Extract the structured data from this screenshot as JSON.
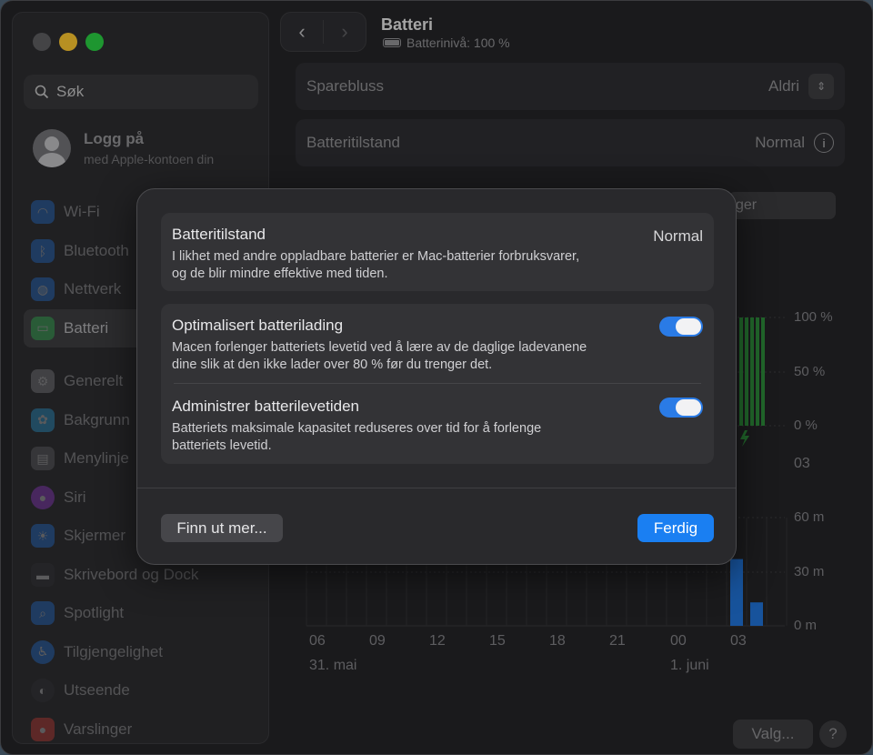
{
  "sidebar": {
    "search_placeholder": "Søk",
    "account": {
      "name": "Logg på",
      "sub": "med Apple-kontoen din"
    },
    "items": [
      {
        "label": "Wi-Fi",
        "icon": "wifi-icon",
        "color": "#2a7be6"
      },
      {
        "label": "Bluetooth",
        "icon": "bluetooth-icon",
        "color": "#2a7be6"
      },
      {
        "label": "Nettverk",
        "icon": "globe-icon",
        "color": "#2a7be6"
      },
      {
        "label": "Batteri",
        "icon": "battery-icon",
        "color": "#34c759"
      },
      {
        "label": "Generelt",
        "icon": "gear-icon",
        "color": "#8e8e93"
      },
      {
        "label": "Bakgrunn",
        "icon": "flower-icon",
        "color": "#2fa7e6"
      },
      {
        "label": "Menylinje",
        "icon": "menubar-icon",
        "color": "#6e6e72"
      },
      {
        "label": "Siri",
        "icon": "siri-icon",
        "color": "#a040e0"
      },
      {
        "label": "Skjermer",
        "icon": "sun-icon",
        "color": "#2a7be6"
      },
      {
        "label": "Skrivebord og Dock",
        "icon": "dock-icon",
        "color": "#3a3a3d"
      },
      {
        "label": "Spotlight",
        "icon": "magnifier-icon",
        "color": "#2a7be6"
      },
      {
        "label": "Tilgjengelighet",
        "icon": "accessibility-icon",
        "color": "#2a7be6"
      },
      {
        "label": "Utseende",
        "icon": "appearance-icon",
        "color": "#3a3a3d"
      },
      {
        "label": "Varslinger",
        "icon": "bell-icon",
        "color": "#e0463c"
      }
    ]
  },
  "header": {
    "title": "Batteri",
    "subtitle": "Batterinivå: 100 %"
  },
  "main": {
    "rows": [
      {
        "label": "Sparebluss",
        "value": "Aldri"
      },
      {
        "label": "Batteritilstand",
        "value": "Normal"
      }
    ],
    "partial_button": "ger",
    "chart": {
      "y_top": [
        "100 %",
        "50 %",
        "0 %"
      ],
      "y_bottom": [
        "60 m",
        "30 m",
        "0 m"
      ],
      "x_ticks": [
        "06",
        "09",
        "12",
        "15",
        "18",
        "21",
        "00",
        "03"
      ],
      "dates": [
        "31. mai",
        "1. juni"
      ],
      "partial_x": "03",
      "top_bar_levels_pct": [
        100,
        100,
        100,
        100,
        100
      ],
      "usage_minutes": [
        37,
        13
      ]
    },
    "valg_label": "Valg...",
    "help_label": "?"
  },
  "sheet": {
    "health": {
      "title": "Batteritilstand",
      "value": "Normal",
      "desc_line1": "I likhet med andre oppladbare batterier er Mac-batterier forbruksvarer,",
      "desc_line2": "og de blir mindre effektive med tiden."
    },
    "optimized": {
      "title": "Optimalisert batterilading",
      "desc_line1": "Macen forlenger batteriets levetid ved å lære av de daglige ladevanene",
      "desc_line2": "dine slik at den ikke lader over 80 % før du trenger det.",
      "enabled": true
    },
    "lifespan": {
      "title": "Administrer batterilevetiden",
      "desc_line1": "Batteriets maksimale kapasitet reduseres over tid for å forlenge",
      "desc_line2": "batteriets levetid.",
      "enabled": true
    },
    "learn_more": "Finn ut mer...",
    "done": "Ferdig"
  }
}
